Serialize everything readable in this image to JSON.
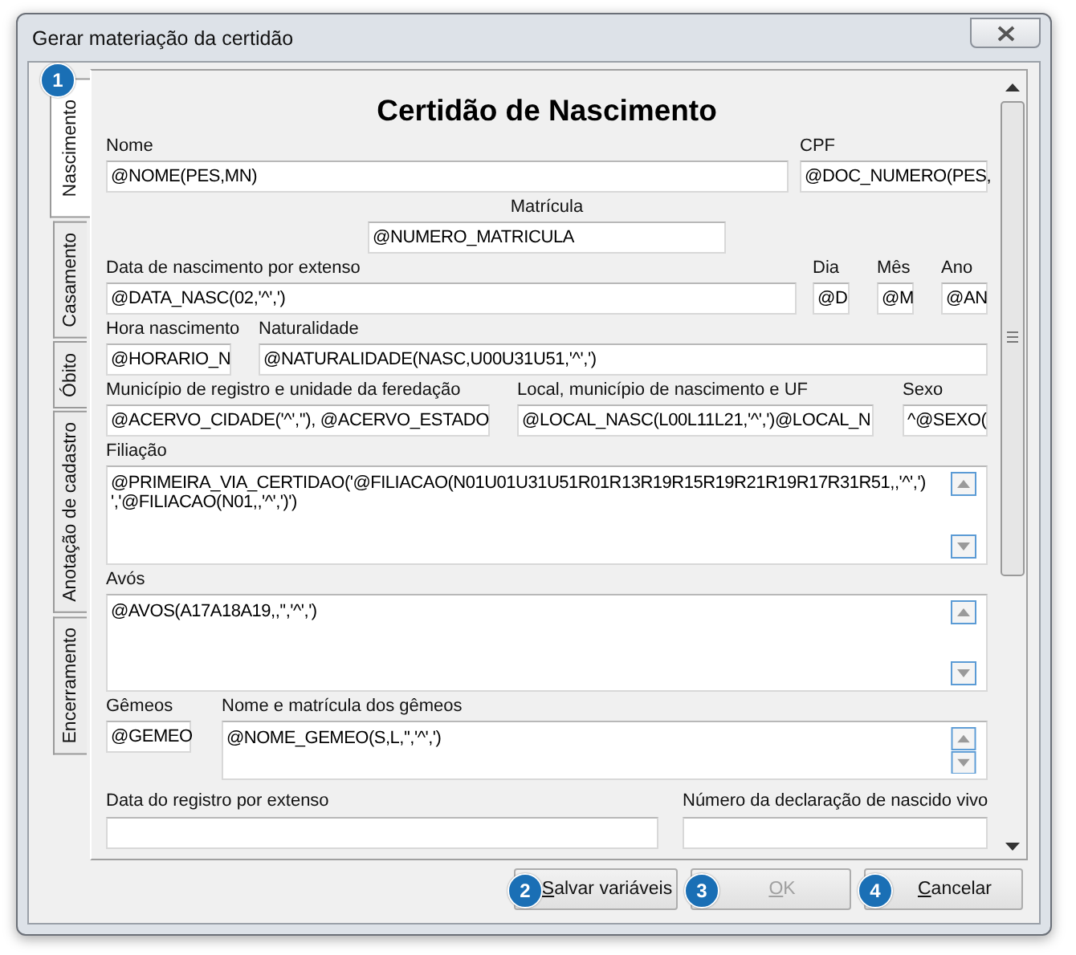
{
  "window": {
    "title": "Gerar materiação da certidão"
  },
  "tabs": [
    {
      "label": "Nascimento",
      "selected": true,
      "badge": "1"
    },
    {
      "label": "Casamento",
      "selected": false
    },
    {
      "label": "Óbito",
      "selected": false
    },
    {
      "label": "Anotação de cadastro",
      "selected": false
    },
    {
      "label": "Encerramento",
      "selected": false
    }
  ],
  "form": {
    "title": "Certidão de Nascimento",
    "rows": [
      {
        "fields": [
          {
            "kind": "line",
            "label": "Nome",
            "value": "@NOME(PES,MN)"
          },
          {
            "kind": "line",
            "label": "CPF",
            "value": "@DOC_NUMERO(PES,"
          }
        ]
      },
      {
        "fields": [
          {
            "kind": "line",
            "label": "Matrícula",
            "value": "@NUMERO_MATRICULA"
          }
        ]
      },
      {
        "fields": [
          {
            "kind": "line",
            "label": "Data de nascimento por extenso",
            "value": "@DATA_NASC(02,'^',')"
          },
          {
            "kind": "line",
            "label": "Dia",
            "value": "@D"
          },
          {
            "kind": "line",
            "label": "Mês",
            "value": "@M"
          },
          {
            "kind": "line",
            "label": "Ano",
            "value": "@AN"
          }
        ]
      },
      {
        "fields": [
          {
            "kind": "line",
            "label": "Hora nascimento",
            "value": "@HORARIO_N"
          },
          {
            "kind": "line",
            "label": "Naturalidade",
            "value": "@NATURALIDADE(NASC,U00U31U51,'^',')"
          }
        ]
      },
      {
        "fields": [
          {
            "kind": "line",
            "label": "Município de registro e unidade da feredação",
            "value": "@ACERVO_CIDADE('^',''), @ACERVO_ESTADO"
          },
          {
            "kind": "line",
            "label": "Local, município de nascimento e UF",
            "value": "@LOCAL_NASC(L00L11L21,'^',')@LOCAL_N"
          },
          {
            "kind": "line",
            "label": "Sexo",
            "value": "^@SEXO("
          }
        ]
      },
      {
        "fields": [
          {
            "kind": "memo",
            "label": "Filiação",
            "value": "@PRIMEIRA_VIA_CERTIDAO('@FILIACAO(N01U01U31U51R01R13R19R15R19R21R19R17R31R51,,'^',') ','@FILIACAO(N01,,'^',')')"
          }
        ]
      },
      {
        "fields": [
          {
            "kind": "memo",
            "label": "Avós",
            "value": "@AVOS(A17A18A19,,'','^',')"
          }
        ]
      },
      {
        "fields": [
          {
            "kind": "line",
            "label": "Gêmeos",
            "value": "@GEMEO"
          },
          {
            "kind": "memo",
            "label": "Nome e matrícula dos gêmeos",
            "value": "@NOME_GEMEO(S,L,'','^',')"
          }
        ]
      },
      {
        "fields": [
          {
            "kind": "cut",
            "label": "Data do registro por extenso"
          },
          {
            "kind": "cut",
            "label": "Número da declaração de nascido vivo"
          }
        ]
      }
    ]
  },
  "buttons": [
    {
      "label": "Salvar variáveis",
      "badge": "2",
      "disabled": false
    },
    {
      "label": "OK",
      "badge": "3",
      "disabled": true
    },
    {
      "label": "Cancelar",
      "badge": "4",
      "disabled": false
    }
  ]
}
